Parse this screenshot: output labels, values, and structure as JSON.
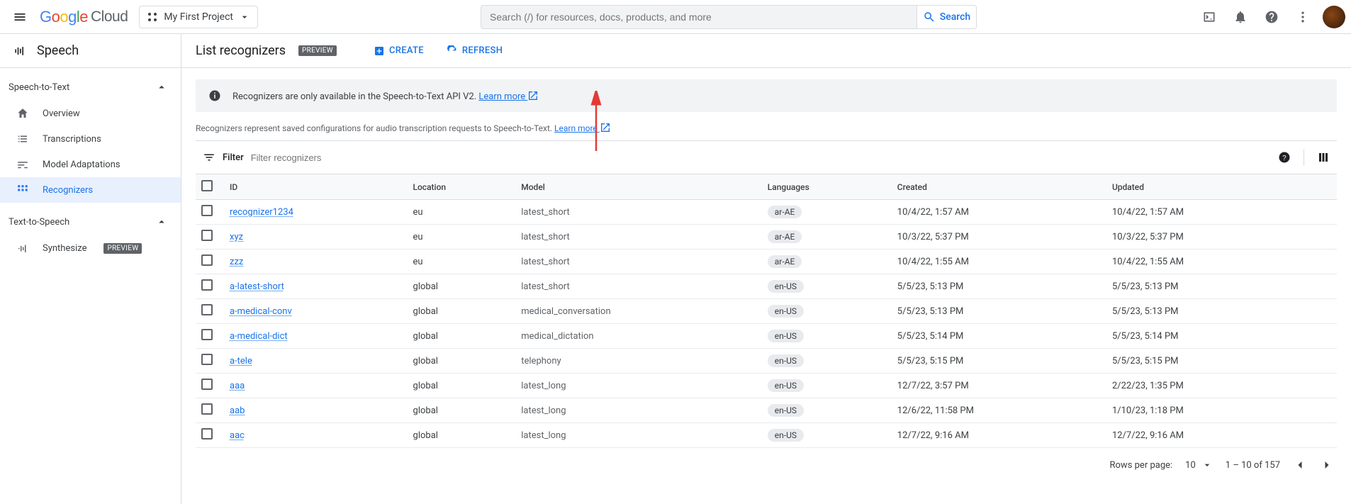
{
  "topbar": {
    "logo_cloud": "Cloud",
    "project_name": "My First Project",
    "search_placeholder": "Search (/) for resources, docs, products, and more",
    "search_button": "Search"
  },
  "sidebar": {
    "product": "Speech",
    "sections": [
      {
        "title": "Speech-to-Text",
        "items": [
          {
            "label": "Overview"
          },
          {
            "label": "Transcriptions"
          },
          {
            "label": "Model Adaptations"
          },
          {
            "label": "Recognizers",
            "active": true
          }
        ]
      },
      {
        "title": "Text-to-Speech",
        "items": [
          {
            "label": "Synthesize",
            "preview": "PREVIEW"
          }
        ]
      }
    ]
  },
  "page": {
    "title": "List recognizers",
    "preview_badge": "PREVIEW",
    "create_label": "CREATE",
    "refresh_label": "REFRESH",
    "banner_text": "Recognizers are only available in the Speech-to-Text API V2. ",
    "banner_link": "Learn more",
    "desc_text": "Recognizers represent saved configurations for audio transcription requests to Speech-to-Text. ",
    "desc_link": "Learn more",
    "filter_label": "Filter",
    "filter_placeholder": "Filter recognizers"
  },
  "table": {
    "headers": [
      "ID",
      "Location",
      "Model",
      "Languages",
      "Created",
      "Updated"
    ],
    "rows": [
      {
        "id": "recognizer1234",
        "loc": "eu",
        "model": "latest_short",
        "lang": "ar-AE",
        "created": "10/4/22, 1:57 AM",
        "updated": "10/4/22, 1:57 AM"
      },
      {
        "id": "xyz",
        "loc": "eu",
        "model": "latest_short",
        "lang": "ar-AE",
        "created": "10/3/22, 5:37 PM",
        "updated": "10/3/22, 5:37 PM"
      },
      {
        "id": "zzz",
        "loc": "eu",
        "model": "latest_short",
        "lang": "ar-AE",
        "created": "10/4/22, 1:55 AM",
        "updated": "10/4/22, 1:55 AM"
      },
      {
        "id": "a-latest-short",
        "loc": "global",
        "model": "latest_short",
        "lang": "en-US",
        "created": "5/5/23, 5:13 PM",
        "updated": "5/5/23, 5:13 PM"
      },
      {
        "id": "a-medical-conv",
        "loc": "global",
        "model": "medical_conversation",
        "lang": "en-US",
        "created": "5/5/23, 5:13 PM",
        "updated": "5/5/23, 5:13 PM"
      },
      {
        "id": "a-medical-dict",
        "loc": "global",
        "model": "medical_dictation",
        "lang": "en-US",
        "created": "5/5/23, 5:14 PM",
        "updated": "5/5/23, 5:14 PM"
      },
      {
        "id": "a-tele",
        "loc": "global",
        "model": "telephony",
        "lang": "en-US",
        "created": "5/5/23, 5:15 PM",
        "updated": "5/5/23, 5:15 PM"
      },
      {
        "id": "aaa",
        "loc": "global",
        "model": "latest_long",
        "lang": "en-US",
        "created": "12/7/22, 3:57 PM",
        "updated": "2/22/23, 1:35 PM"
      },
      {
        "id": "aab",
        "loc": "global",
        "model": "latest_long",
        "lang": "en-US",
        "created": "12/6/22, 11:58 PM",
        "updated": "1/10/23, 1:18 PM"
      },
      {
        "id": "aac",
        "loc": "global",
        "model": "latest_long",
        "lang": "en-US",
        "created": "12/7/22, 9:16 AM",
        "updated": "12/7/22, 9:16 AM"
      }
    ]
  },
  "pagination": {
    "rows_per_page_label": "Rows per page:",
    "rows_per_page_value": "10",
    "range": "1 – 10 of 157"
  }
}
